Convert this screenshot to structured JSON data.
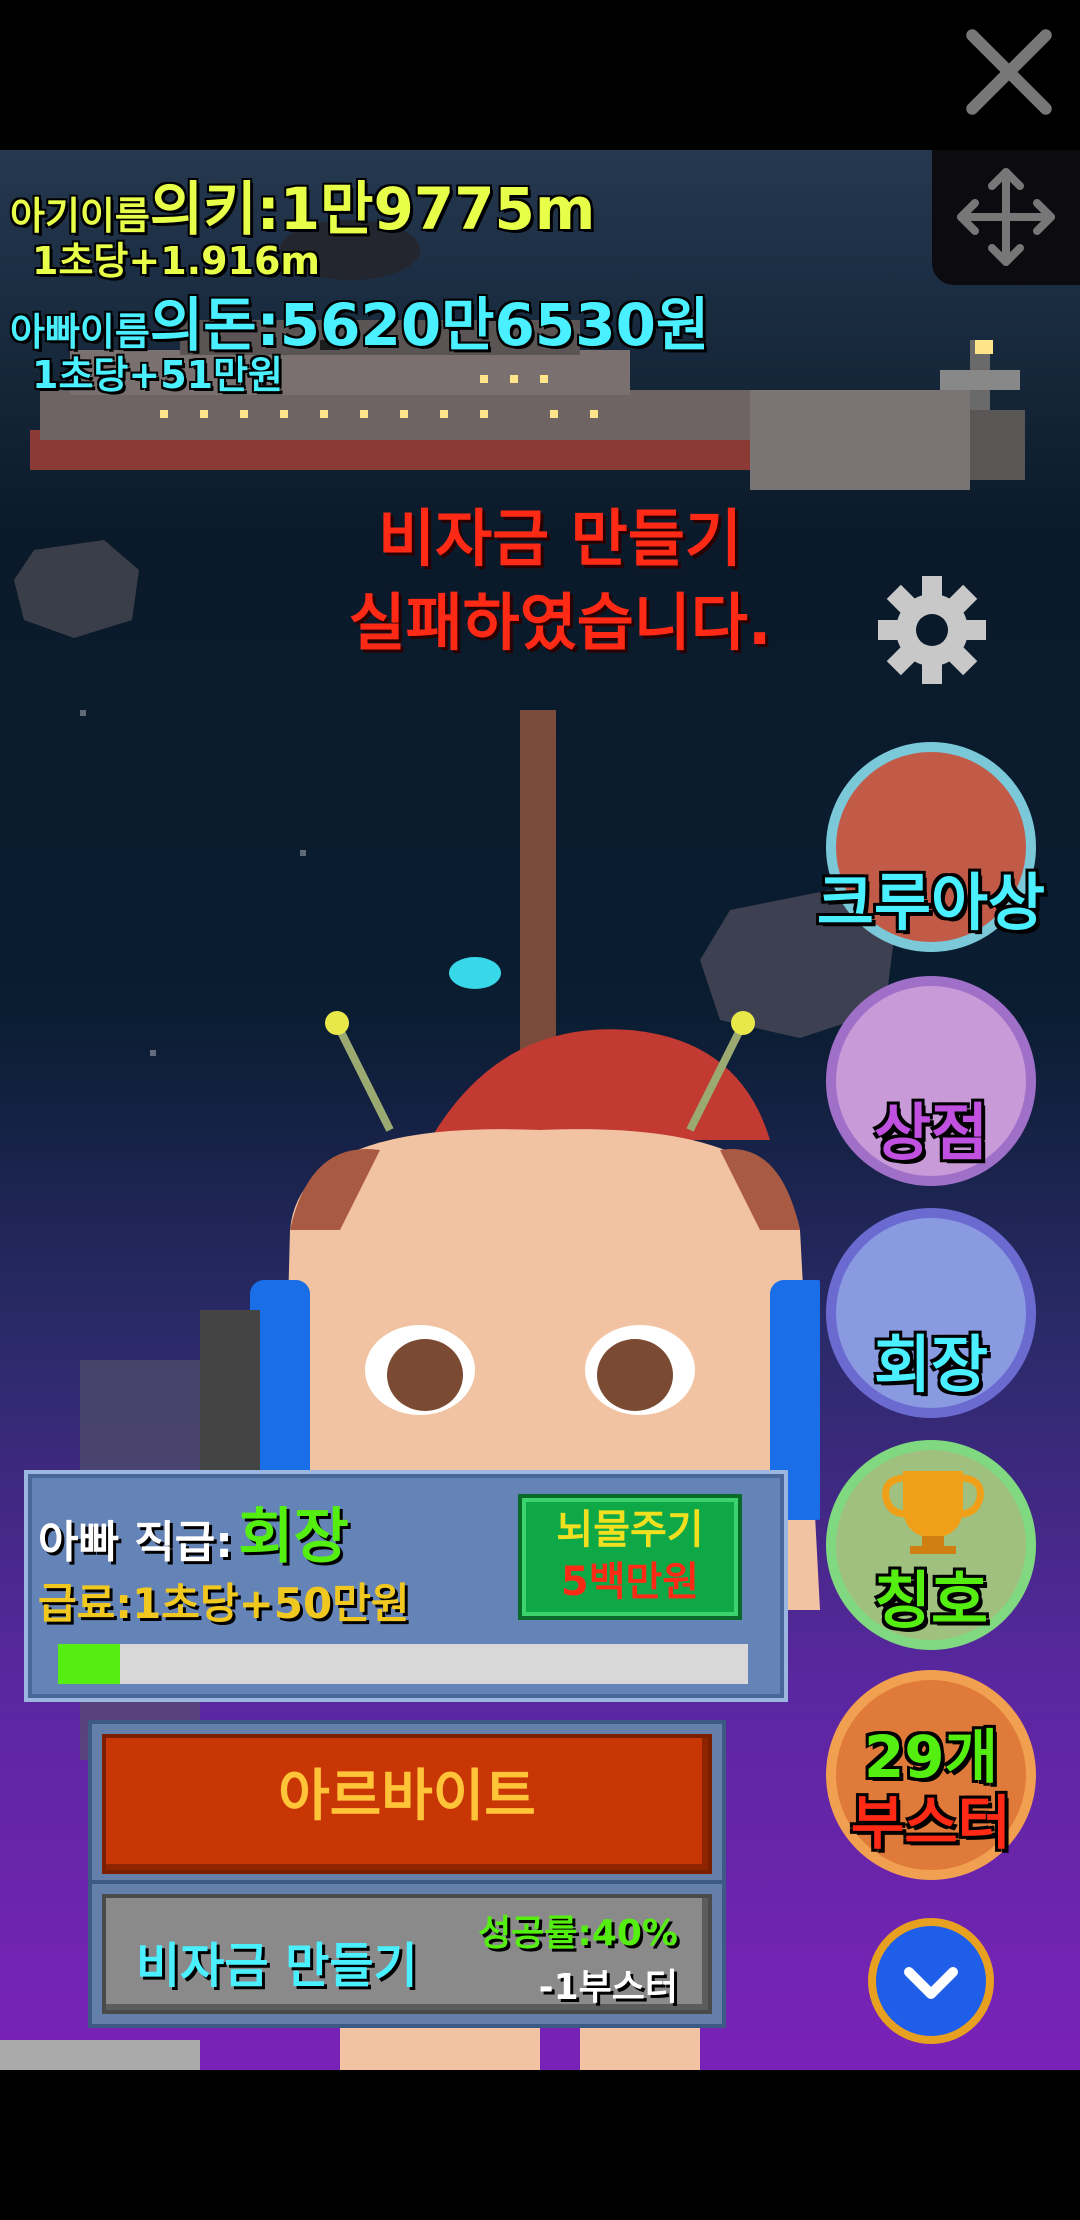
{
  "window": {
    "close_icon": "close-icon",
    "move_icon": "move-arrows-icon"
  },
  "stats": {
    "baby_prefix": "아기이름",
    "baby_name_distance": "의키:1만9775m",
    "baby_rate": "1초당+1.916m",
    "dad_prefix": "아빠이름",
    "dad_name_money": "의돈:5620만6530원",
    "dad_rate": "1초당+51만원"
  },
  "message": {
    "line1": "비자금 만들기",
    "line2": "실패하였습니다."
  },
  "side_menu": {
    "settings_icon": "gear-icon",
    "crew_label": "크루아상",
    "shop_label": "상점",
    "chairman_label": "회장",
    "title_label": "칭호",
    "booster_count": "29개",
    "booster_label": "부스터",
    "scroll_icon": "chevron-down-icon"
  },
  "job_panel": {
    "job_prefix": "아빠 직급:",
    "job_title": "회장",
    "salary": "급료:1초당+50만원",
    "bribe_line1": "뇌물주기",
    "bribe_line2": "5백만원",
    "progress": 0.09
  },
  "actions": {
    "parttime_label": "아르바이트",
    "slush_label": "비자금 만들기",
    "success_rate": "성공률:40%",
    "cost": "-1부스터"
  },
  "colors": {
    "yellow": "#e8ff4a",
    "cyan": "#4af0ff",
    "red": "#ff2a16",
    "green": "#55ee11"
  }
}
